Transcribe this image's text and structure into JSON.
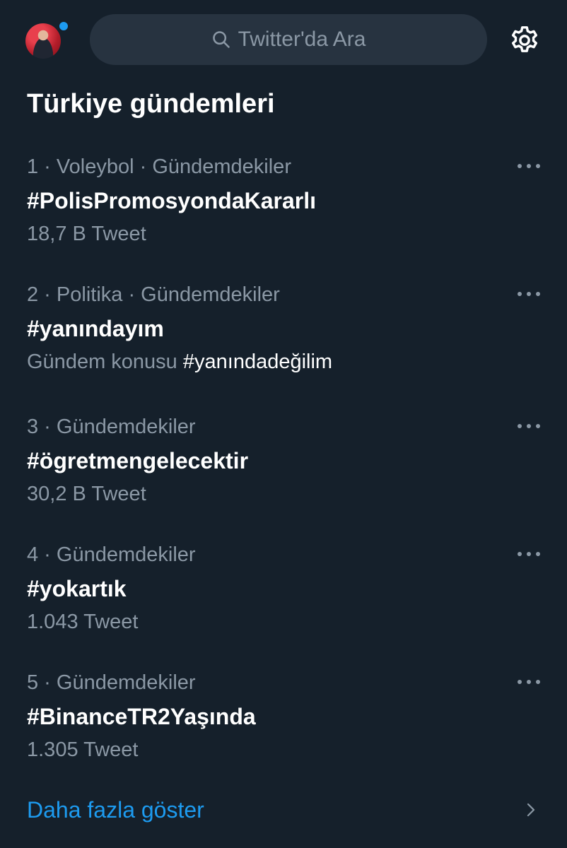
{
  "header": {
    "search_placeholder": "Twitter'da Ara"
  },
  "section_title": "Türkiye gündemleri",
  "trends": [
    {
      "meta": "1 · Voleybol · Gündemdekiler",
      "name": "#PolisPromosyondaKararlı",
      "sub": "18,7 B Tweet"
    },
    {
      "meta": "2 · Politika · Gündemdekiler",
      "name": "#yanındayım",
      "sub_prefix": "Gündem konusu",
      "sub_tag": "#yanındadeğilim"
    },
    {
      "meta": "3 · Gündemdekiler",
      "name": "#ögretmengelecektir",
      "sub": "30,2 B Tweet"
    },
    {
      "meta": "4 · Gündemdekiler",
      "name": "#yokartık",
      "sub": "1.043 Tweet"
    },
    {
      "meta": "5 · Gündemdekiler",
      "name": "#BinanceTR2Yaşında",
      "sub": "1.305 Tweet"
    }
  ],
  "show_more": "Daha fazla göster",
  "colors": {
    "background": "#15202b",
    "search_bg": "#273340",
    "secondary_text": "#8b98a5",
    "accent": "#1d9bf0"
  },
  "icons": [
    "avatar",
    "notification-dot",
    "search-icon",
    "gear-icon",
    "more-icon",
    "chevron-right-icon"
  ]
}
